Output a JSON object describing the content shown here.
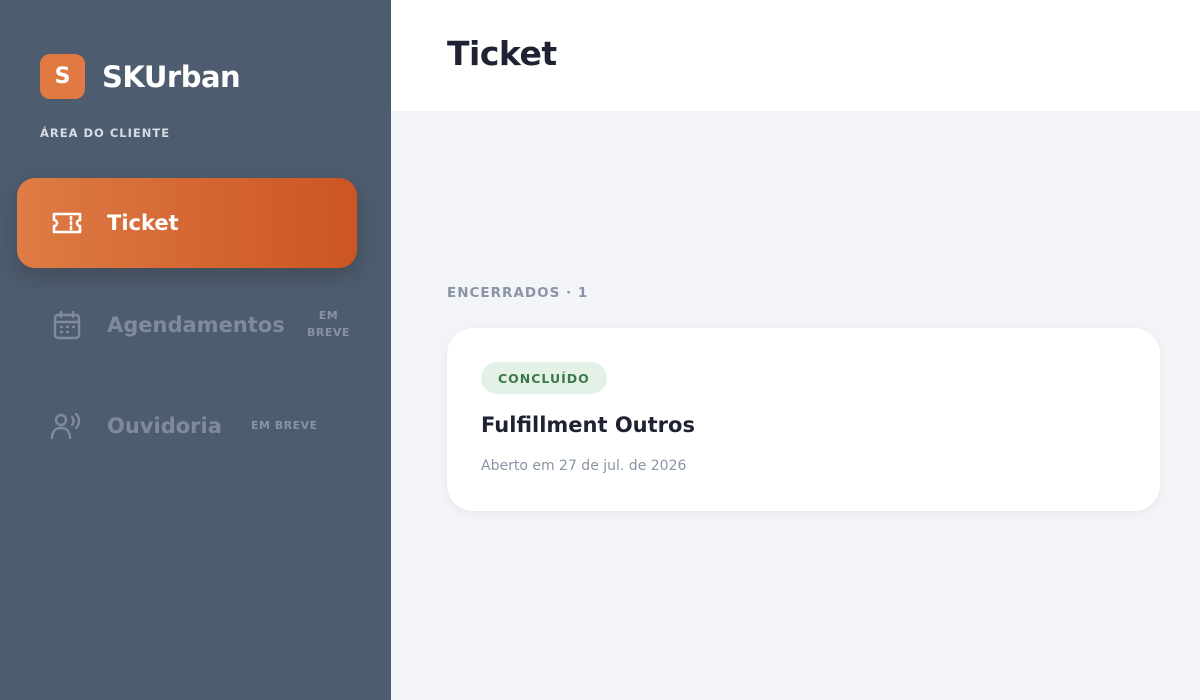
{
  "brand": {
    "logo_letter": "S",
    "name": "SKUrban",
    "area_label": "ÁREA DO CLIENTE"
  },
  "sidebar": {
    "items": [
      {
        "label": "Ticket",
        "icon": "ticket-icon",
        "active": true
      },
      {
        "label": "Agendamentos",
        "icon": "calendar-icon",
        "soon_line1": "EM",
        "soon_line2": "BREVE"
      },
      {
        "label": "Ouvidoria",
        "icon": "person-voice-icon",
        "soon": "EM BREVE"
      }
    ]
  },
  "header": {
    "title": "Ticket"
  },
  "main": {
    "section_label": "ENCERRADOS · 1",
    "tickets": [
      {
        "status": "CONCLUÍDO",
        "title": "Fulfillment Outros",
        "opened": "Aberto em 27 de jul. de 2026"
      }
    ]
  },
  "colors": {
    "sidebar_bg": "#4d5c6f",
    "accent": "#d36431",
    "badge_bg": "#e4f1e7",
    "badge_text": "#3c7a4a"
  }
}
